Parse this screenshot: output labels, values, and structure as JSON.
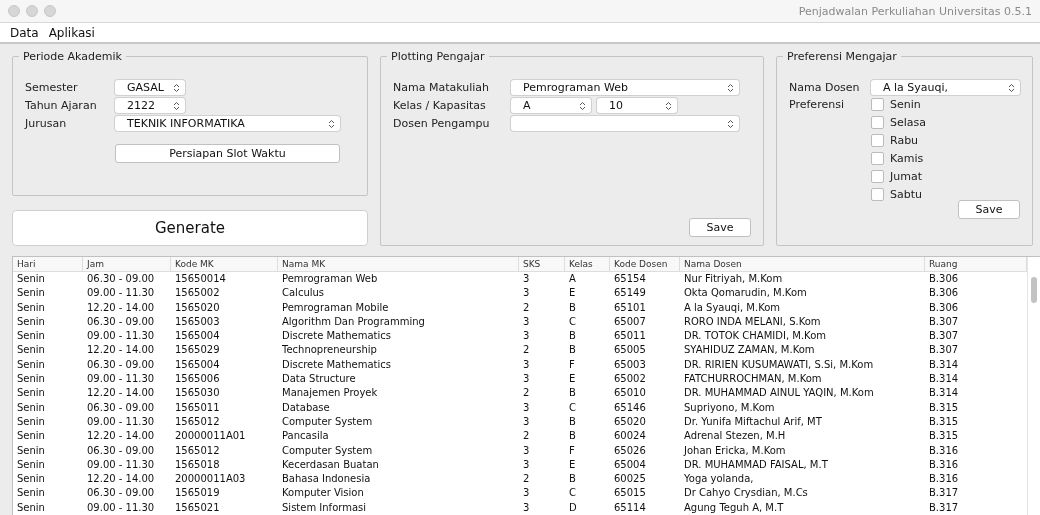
{
  "window": {
    "title": "Penjadwalan Perkuliahan Universitas 0.5.1"
  },
  "menu": [
    "Data",
    "Aplikasi"
  ],
  "periode_akademik": {
    "title": "Periode Akademik",
    "fields": [
      {
        "label": "Semester",
        "value": "GASAL"
      },
      {
        "label": "Tahun Ajaran",
        "value": "2122"
      },
      {
        "label": "Jurusan",
        "value": "TEKNIK INFORMATIKA"
      }
    ],
    "button": "Persiapan Slot Waktu"
  },
  "generate_button": "Generate",
  "plotting_pengajar": {
    "title": "Plotting Pengajar",
    "nama_matakuliah": {
      "label": "Nama Matakuliah",
      "value": "Pemrograman Web"
    },
    "kelas_kapasitas": {
      "label": "Kelas / Kapasitas",
      "kelas": "A",
      "kapasitas": "10"
    },
    "dosen_pengampu": {
      "label": "Dosen Pengampu"
    },
    "button": "Save"
  },
  "preferensi_mengajar": {
    "title": "Preferensi Mengajar",
    "nama_dosen": {
      "label": "Nama Dosen",
      "value": "A la Syauqi,"
    },
    "preferensi_label": "Preferensi",
    "days": [
      {
        "label": "Senin",
        "checked": false
      },
      {
        "label": "Selasa",
        "checked": false
      },
      {
        "label": "Rabu",
        "checked": false
      },
      {
        "label": "Kamis",
        "checked": false
      },
      {
        "label": "Jumat",
        "checked": false
      },
      {
        "label": "Sabtu",
        "checked": false
      }
    ],
    "button": "Save"
  },
  "table": {
    "columns": [
      "Hari",
      "Jam",
      "Kode MK",
      "Nama MK",
      "SKS",
      "Kelas",
      "Kode Dosen",
      "Nama Dosen",
      "Ruang"
    ],
    "rows": [
      [
        "Senin",
        "06.30 - 09.00",
        "15650014",
        "Pemrograman Web",
        "3",
        "A",
        "65154",
        "Nur Fitriyah, M.Kom",
        "B.306"
      ],
      [
        "Senin",
        "09.00 - 11.30",
        "1565002",
        "Calculus",
        "3",
        "E",
        "65149",
        "Okta Qomarudin, M.Kom",
        "B.306"
      ],
      [
        "Senin",
        "12.20 - 14.00",
        "1565020",
        "Pemrograman Mobile",
        "2",
        "B",
        "65101",
        "A la Syauqi, M.Kom",
        "B.306"
      ],
      [
        "Senin",
        "06.30 - 09.00",
        "1565003",
        "Algorithm Dan Programming",
        "3",
        "C",
        "65007",
        "RORO INDA MELANI, S.Kom",
        "B.307"
      ],
      [
        "Senin",
        "09.00 - 11.30",
        "1565004",
        "Discrete Mathematics",
        "3",
        "B",
        "65011",
        "DR. TOTOK CHAMIDI, M.Kom",
        "B.307"
      ],
      [
        "Senin",
        "12.20 - 14.00",
        "1565029",
        "Technopreneurship",
        "2",
        "B",
        "65005",
        "SYAHIDUZ ZAMAN, M.Kom",
        "B.307"
      ],
      [
        "Senin",
        "06.30 - 09.00",
        "1565004",
        "Discrete Mathematics",
        "3",
        "F",
        "65003",
        "DR. RIRIEN KUSUMAWATI, S.Si, M.Kom",
        "B.314"
      ],
      [
        "Senin",
        "09.00 - 11.30",
        "1565006",
        "Data Structure",
        "3",
        "E",
        "65002",
        "FATCHURROCHMAN, M.Kom",
        "B.314"
      ],
      [
        "Senin",
        "12.20 - 14.00",
        "1565030",
        "Manajemen Proyek",
        "2",
        "B",
        "65010",
        "DR. MUHAMMAD AINUL YAQIN, M.Kom",
        "B.314"
      ],
      [
        "Senin",
        "06.30 - 09.00",
        "1565011",
        "Database",
        "3",
        "C",
        "65146",
        "Supriyono, M.Kom",
        "B.315"
      ],
      [
        "Senin",
        "09.00 - 11.30",
        "1565012",
        "Computer System",
        "3",
        "B",
        "65020",
        "Dr. Yunifa Miftachul Arif, MT",
        "B.315"
      ],
      [
        "Senin",
        "12.20 - 14.00",
        "20000011A01",
        "Pancasila",
        "2",
        "B",
        "60024",
        "Adrenal Stezen, M.H",
        "B.315"
      ],
      [
        "Senin",
        "06.30 - 09.00",
        "1565012",
        "Computer System",
        "3",
        "F",
        "65026",
        "Johan Ericka, M.Kom",
        "B.316"
      ],
      [
        "Senin",
        "09.00 - 11.30",
        "1565018",
        "Kecerdasan Buatan",
        "3",
        "E",
        "65004",
        "DR. MUHAMMAD FAISAL, M.T",
        "B.316"
      ],
      [
        "Senin",
        "12.20 - 14.00",
        "20000011A03",
        "Bahasa Indonesia",
        "2",
        "B",
        "60025",
        "Yoga yolanda,",
        "B.316"
      ],
      [
        "Senin",
        "06.30 - 09.00",
        "1565019",
        "Komputer Vision",
        "3",
        "C",
        "65015",
        "Dr Cahyo Crysdian, M.Cs",
        "B.317"
      ],
      [
        "Senin",
        "09.00 - 11.30",
        "1565021",
        "Sistem Informasi",
        "3",
        "D",
        "65114",
        "Agung Teguh A, M.T",
        "B.317"
      ]
    ]
  }
}
